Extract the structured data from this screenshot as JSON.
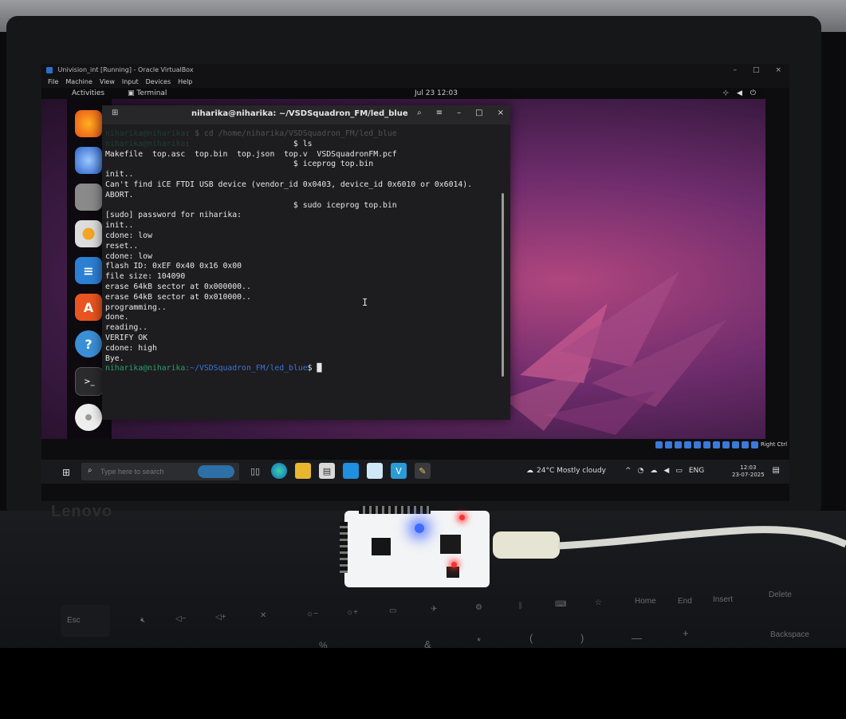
{
  "vbox": {
    "title": "Univision_int [Running] - Oracle VirtualBox",
    "menu": [
      "File",
      "Machine",
      "View",
      "Input",
      "Devices",
      "Help"
    ],
    "controls": [
      "–",
      "□",
      "×"
    ],
    "host_key": "Right Ctrl"
  },
  "gnome": {
    "activities": "Activities",
    "app_name": "Terminal",
    "clock": "Jul 23  12:03",
    "tray": [
      "network-icon",
      "volume-icon",
      "power-icon"
    ]
  },
  "dock": {
    "items": [
      "firefox",
      "thunderbird",
      "files",
      "rhythmbox",
      "libreoffice-writer",
      "app-center",
      "help",
      "terminal",
      "cd-drive"
    ]
  },
  "terminal": {
    "title": "niharika@niharika: ~/VSDSquadron_FM/led_blue",
    "prompt_user": "niharika@niharika",
    "prompt_path": "~/VSDSquadron_FM/led_blue",
    "lines": [
      {
        "kind": "cmd",
        "blur": true,
        "prefix_user": "niharika@niharika",
        "prefix_path": "",
        "text": ": $ cd /home/niharika/VSDSquadron_FM/led_blue",
        "indent": ""
      },
      {
        "kind": "cmd",
        "blur": true,
        "prefix_user": "niharika@niharika",
        "prefix_path": "",
        "text": ":",
        "indent": ""
      },
      {
        "kind": "out",
        "blur": false,
        "text": "                                        $ ls"
      },
      {
        "kind": "out",
        "blur": false,
        "text": "Makefile  top.asc  top.bin  top.json  top.v  VSDSquadronFM.pcf"
      },
      {
        "kind": "out",
        "blur": false,
        "text": "                                        $ iceprog top.bin"
      },
      {
        "kind": "out",
        "blur": false,
        "text": "init.."
      },
      {
        "kind": "out",
        "blur": false,
        "text": "Can't find iCE FTDI USB device (vendor_id 0x0403, device_id 0x6010 or 0x6014)."
      },
      {
        "kind": "out",
        "blur": false,
        "text": "ABORT."
      },
      {
        "kind": "out",
        "blur": false,
        "text": "                                        $ sudo iceprog top.bin"
      },
      {
        "kind": "out",
        "blur": false,
        "text": "[sudo] password for niharika:"
      },
      {
        "kind": "out",
        "blur": false,
        "text": "init.."
      },
      {
        "kind": "out",
        "blur": false,
        "text": "cdone: low"
      },
      {
        "kind": "out",
        "blur": false,
        "text": "reset.."
      },
      {
        "kind": "out",
        "blur": false,
        "text": "cdone: low"
      },
      {
        "kind": "out",
        "blur": false,
        "text": "flash ID: 0xEF 0x40 0x16 0x00"
      },
      {
        "kind": "out",
        "blur": false,
        "text": "file size: 104090"
      },
      {
        "kind": "out",
        "blur": false,
        "text": "erase 64kB sector at 0x000000.."
      },
      {
        "kind": "out",
        "blur": false,
        "text": "erase 64kB sector at 0x010000.."
      },
      {
        "kind": "out",
        "blur": false,
        "text": "programming.."
      },
      {
        "kind": "out",
        "blur": false,
        "text": "done."
      },
      {
        "kind": "out",
        "blur": false,
        "text": "reading.."
      },
      {
        "kind": "out",
        "blur": false,
        "text": "VERIFY OK"
      },
      {
        "kind": "out",
        "blur": false,
        "text": "cdone: high"
      },
      {
        "kind": "out",
        "blur": false,
        "text": "Bye."
      }
    ],
    "final_prompt_user": "niharika@niharika",
    "final_prompt_path": ":~/VSDSquadron_FM/led_blue",
    "final_prompt_symbol": "$ ",
    "cursor": "█"
  },
  "taskbar": {
    "search_placeholder": "Type here to search",
    "weather_temp": "24°C",
    "weather_text": "Mostly cloudy",
    "language": "ENG",
    "time": "12:03",
    "date": "23-07-2025"
  },
  "laptop": {
    "brand": "Lenovo"
  },
  "keyboard": {
    "keys": [
      "Esc",
      "Home",
      "End",
      "Insert",
      "Delete",
      "Backspace",
      "&",
      "*",
      "(",
      ")",
      "—",
      "+",
      "%"
    ]
  },
  "colors": {
    "prompt_green": "#26a269",
    "path_blue": "#3a76d6",
    "led_blue": "#3f6bff",
    "led_red": "#ff3030"
  }
}
